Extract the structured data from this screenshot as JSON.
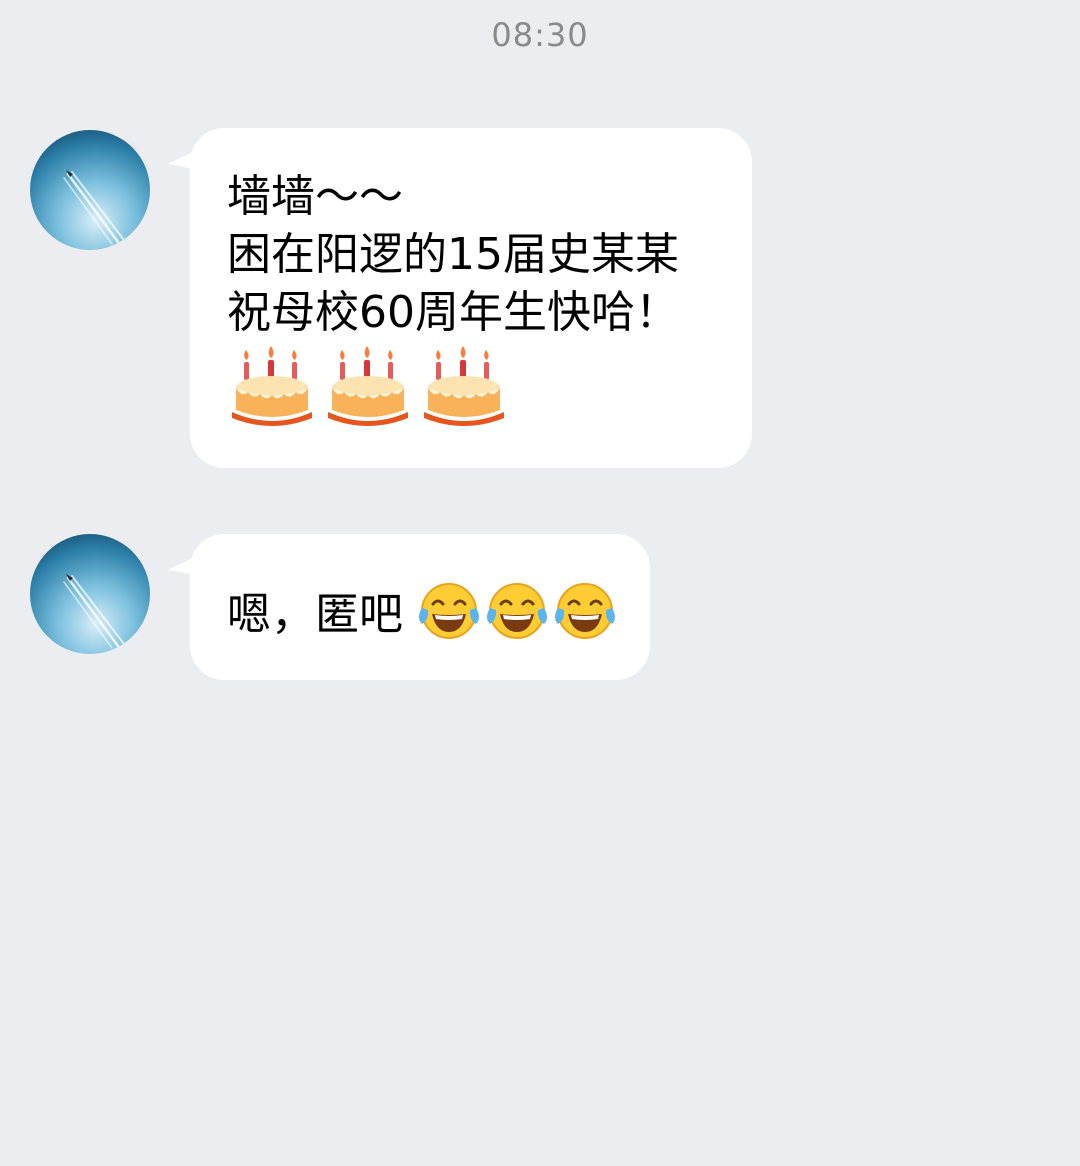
{
  "timestamp": "08:30",
  "messages": [
    {
      "lines": [
        "墙墙～～",
        "困在阳逻的15届史某某",
        "祝母校60周年生快哈！"
      ],
      "emojis": [
        "birthday-cake-emoji",
        "birthday-cake-emoji",
        "birthday-cake-emoji"
      ]
    },
    {
      "text": "嗯，匿吧",
      "emojis": [
        "tears-of-joy-emoji",
        "tears-of-joy-emoji",
        "tears-of-joy-emoji"
      ]
    }
  ],
  "colors": {
    "background": "#ebedf1",
    "bubble": "#ffffff",
    "timestamp": "#8a8a8a"
  }
}
